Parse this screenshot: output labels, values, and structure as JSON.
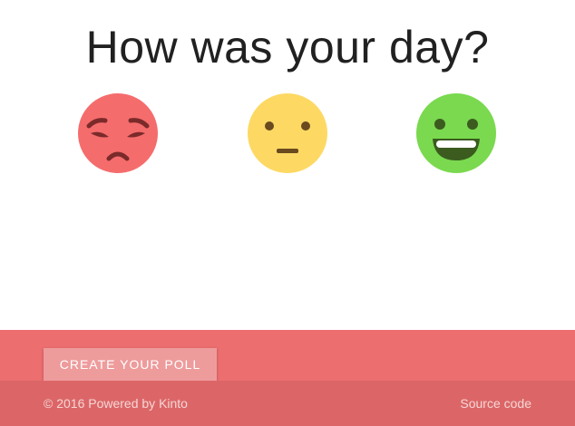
{
  "poll": {
    "question": "How was your day?",
    "options": [
      {
        "mood": "sad",
        "icon": "sad-face-icon",
        "color": "#f56c6c"
      },
      {
        "mood": "neutral",
        "icon": "neutral-face-icon",
        "color": "#fdd964"
      },
      {
        "mood": "happy",
        "icon": "happy-face-icon",
        "color": "#7ad94f"
      }
    ]
  },
  "footer": {
    "create_poll_label": "Create your poll",
    "copyright_prefix": "© 2016 Powered by ",
    "powered_by_link": "Kinto",
    "source_code_link": "Source code",
    "background_color": "#ec6e6f"
  }
}
